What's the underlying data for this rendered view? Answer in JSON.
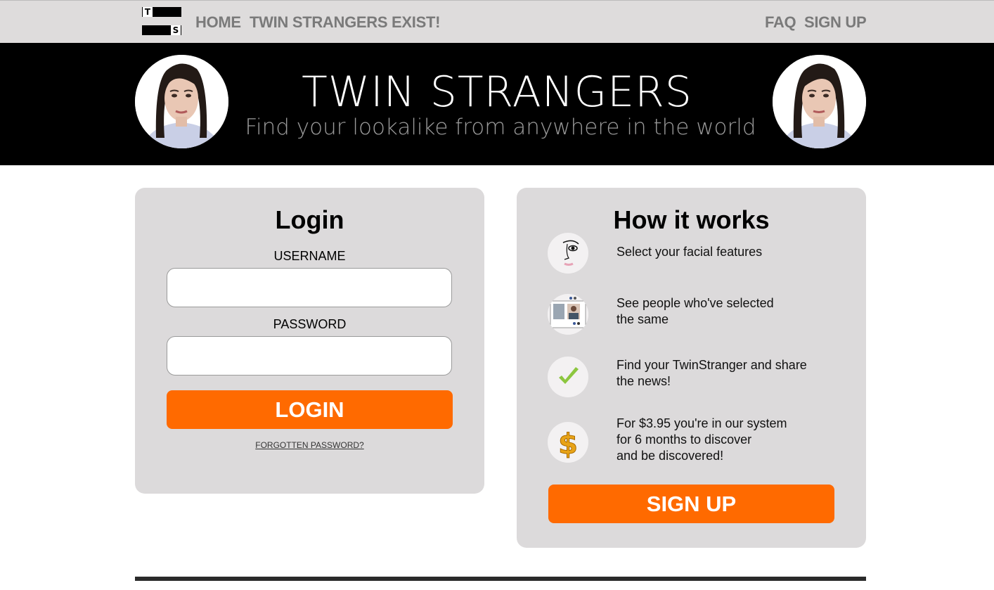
{
  "nav": {
    "logo_letters": [
      "T",
      "S"
    ],
    "home": "HOME",
    "twins_exist": "TWIN STRANGERS EXIST!",
    "faq": "FAQ",
    "sign_up": "SIGN UP"
  },
  "hero": {
    "title": "TWIN STRANGERS",
    "subtitle": "Find your lookalike from anywhere in the world"
  },
  "login": {
    "title": "Login",
    "username_label": "USERNAME",
    "username_value": "",
    "password_label": "PASSWORD",
    "password_value": "",
    "button": "LOGIN",
    "forgot": "FORGOTTEN PASSWORD?"
  },
  "how": {
    "title": "How it works",
    "steps": [
      {
        "icon": "facial-features-icon",
        "lines": [
          "Select your facial features"
        ]
      },
      {
        "icon": "matches-screen-icon",
        "lines": [
          "See people who've selected",
          "the same"
        ]
      },
      {
        "icon": "checkmark-icon",
        "lines": [
          "Find your TwinStranger and share",
          "the news!"
        ]
      },
      {
        "icon": "dollar-icon",
        "lines": [
          "For $3.95 you're in our system",
          "for 6 months to discover",
          "and be discovered!"
        ]
      }
    ],
    "button": "SIGN UP"
  },
  "colors": {
    "accent": "#ff6a00",
    "nav_bg": "#dedcdc",
    "card_bg": "#dcdadb",
    "hero_bg": "#000000",
    "nav_text": "#7a7a7a",
    "check_green": "#8cc63f",
    "dollar_gold": "#e8a317"
  }
}
